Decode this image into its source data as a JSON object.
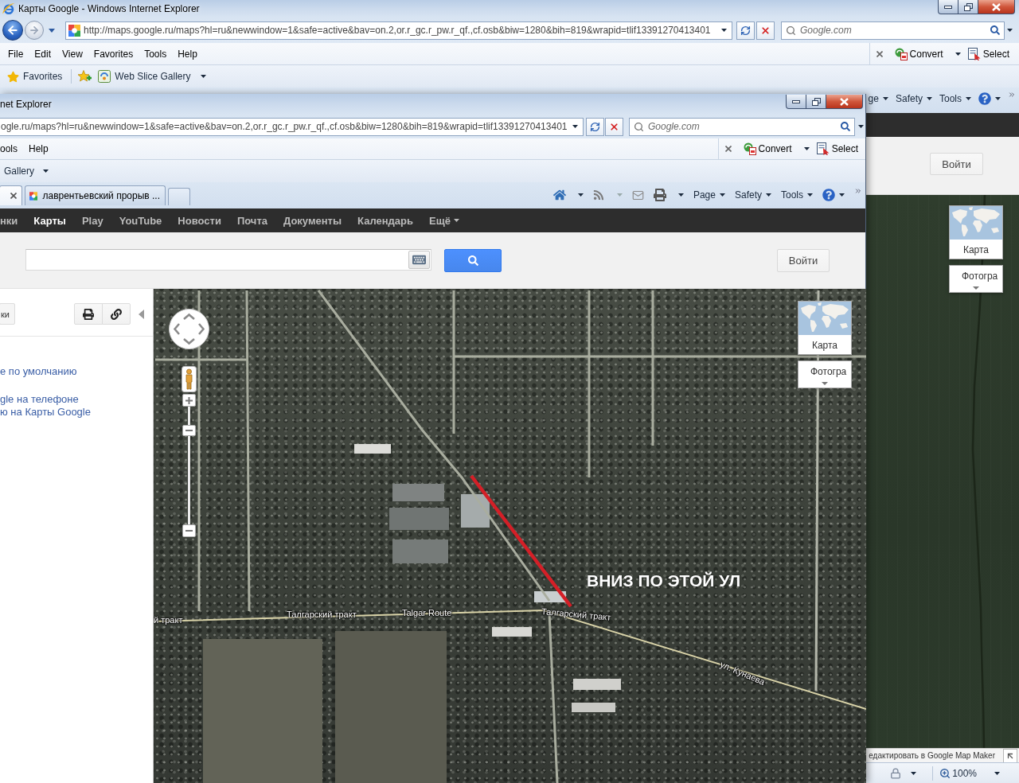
{
  "outer_window": {
    "title": "Карты Google - Windows Internet Explorer",
    "address": "http://maps.google.ru/maps?hl=ru&newwindow=1&safe=active&bav=on.2,or.r_gc.r_pw.r_qf.,cf.osb&biw=1280&bih=819&wrapid=tlif13391270413401",
    "search_placeholder": "Google.com",
    "menu": [
      "File",
      "Edit",
      "View",
      "Favorites",
      "Tools",
      "Help"
    ],
    "commands": [
      {
        "label": "Convert",
        "kind": "convert"
      },
      {
        "label": "Select",
        "kind": "select"
      }
    ],
    "favorites_bar": {
      "favorites": "Favorites",
      "web_slice": "Web Slice Gallery"
    },
    "toolbar": [
      "ge",
      "Safety",
      "Tools"
    ],
    "sign_in": "Войти",
    "map_types": [
      {
        "label": "Карта",
        "kind": "map"
      },
      {
        "label": "Фотогра",
        "kind": "satellite"
      }
    ],
    "map_maker_link": "едактировать в Google Map Maker",
    "status_bar": {
      "zoom": "100%"
    }
  },
  "inner_window": {
    "title": "net Explorer",
    "address": "ogle.ru/maps?hl=ru&newwindow=1&safe=active&bav=on.2,or.r_gc.r_pw.r_qf.,cf.osb&biw=1280&bih=819&wrapid=tlif13391270413401",
    "search_placeholder": "Google.com",
    "menu": [
      "ools",
      "Help"
    ],
    "commands": [
      {
        "label": "Convert",
        "kind": "convert"
      },
      {
        "label": "Select",
        "kind": "select"
      }
    ],
    "favorites_bar": {
      "web_slice": "Gallery"
    },
    "tabs": [
      {
        "selected": true
      },
      {
        "label": "лаврентьевский прорыв ...",
        "selected": false
      }
    ],
    "toolbar": [
      "Page",
      "Safety",
      "Tools"
    ],
    "google_bar": [
      {
        "label": "нки",
        "selected": false,
        "kind": "link"
      },
      {
        "label": "Карты",
        "selected": true,
        "kind": "link"
      },
      {
        "label": "Play",
        "selected": false,
        "kind": "link"
      },
      {
        "label": "YouTube",
        "selected": false,
        "kind": "link"
      },
      {
        "label": "Новости",
        "selected": false,
        "kind": "link"
      },
      {
        "label": "Почта",
        "selected": false,
        "kind": "link"
      },
      {
        "label": "Документы",
        "selected": false,
        "kind": "link"
      },
      {
        "label": "Календарь",
        "selected": false,
        "kind": "link"
      },
      {
        "label": "Ещё",
        "selected": false,
        "kind": "menu"
      }
    ],
    "sign_in": "Войти",
    "side_panel": {
      "tab_button": "ки",
      "links": [
        "е по умолчанию",
        "gle на телефоне",
        "ю на Карты Google"
      ]
    },
    "map": {
      "zoom": {
        "level": 0.83
      },
      "map_types": [
        {
          "label": "Карта",
          "kind": "map"
        },
        {
          "label": "Фотогра",
          "kind": "satellite"
        }
      ],
      "note": "ВНИЗ ПО ЭТОЙ УЛ",
      "road_labels": [
        "й тракт",
        "Талгарский тракт",
        "Talgar Route",
        "Талгарский тракт",
        "ул. Кунаева"
      ]
    }
  }
}
